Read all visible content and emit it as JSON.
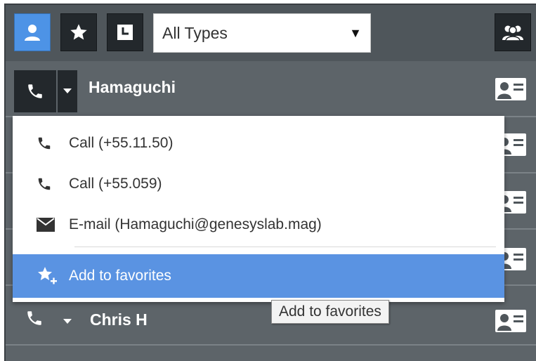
{
  "toolbar": {
    "type_filter": {
      "selected": "All Types"
    }
  },
  "contacts": [
    {
      "name": "Hamaguchi"
    },
    {
      "name": "Chris H"
    }
  ],
  "context_menu": {
    "items": [
      {
        "icon": "phone-icon",
        "label": "Call (+55.11.50)"
      },
      {
        "icon": "phone-icon",
        "label": "Call (+55.059)"
      },
      {
        "icon": "mail-icon",
        "label": "E-mail (Hamaguchi@genesyslab.mag)"
      },
      {
        "icon": "star-plus-icon",
        "label": "Add to favorites",
        "highlighted": true
      }
    ]
  },
  "tooltip": {
    "text": "Add to favorites"
  },
  "colors": {
    "accent": "#4d93e6",
    "highlight": "#5a93e2",
    "panel": "#5d6469",
    "button": "#23282c"
  }
}
